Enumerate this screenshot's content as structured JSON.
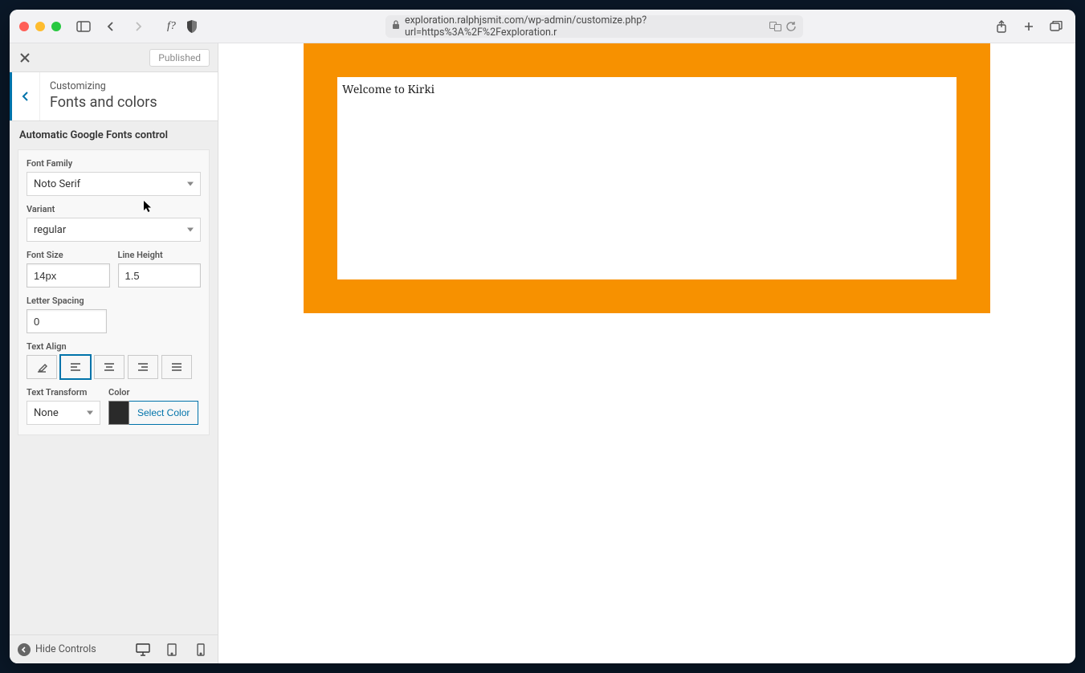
{
  "browser": {
    "url": "exploration.ralphjsmit.com/wp-admin/customize.php?url=https%3A%2F%2Fexploration.r"
  },
  "sidebar": {
    "published_label": "Published",
    "eyebrow": "Customizing",
    "title": "Fonts and colors",
    "section_title": "Automatic Google Fonts control",
    "controls": {
      "font_family": {
        "label": "Font Family",
        "value": "Noto Serif"
      },
      "variant": {
        "label": "Variant",
        "value": "regular"
      },
      "font_size": {
        "label": "Font Size",
        "value": "14px"
      },
      "line_height": {
        "label": "Line Height",
        "value": "1.5"
      },
      "letter_spacing": {
        "label": "Letter Spacing",
        "value": "0"
      },
      "text_align": {
        "label": "Text Align"
      },
      "text_transform": {
        "label": "Text Transform",
        "value": "None"
      },
      "color": {
        "label": "Color",
        "select_label": "Select Color",
        "swatch_hex": "#2a2a2a"
      }
    },
    "footer": {
      "hide_controls_label": "Hide Controls"
    }
  },
  "preview": {
    "heading": "Welcome to Kirki"
  }
}
